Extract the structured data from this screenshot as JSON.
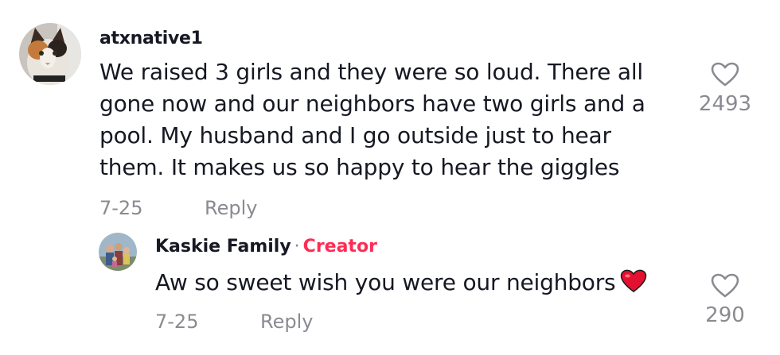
{
  "comment": {
    "username": "atxnative1",
    "avatar_icon": "calico-cat-avatar",
    "text": "We raised 3 girls and they were so loud. There all gone now and our neighbors have two girls and a pool. My husband and I go outside just to hear them. It makes us so happy to hear the giggles",
    "date": "7-25",
    "reply_label": "Reply",
    "like_icon": "heart-outline-icon",
    "like_count": "2493"
  },
  "reply": {
    "username": "Kaskie Family",
    "separator": "·",
    "badge": "Creator",
    "avatar_icon": "family-photo-avatar",
    "text": "Aw so sweet wish you were our neighbors",
    "emoji": "red-heart-emoji",
    "date": "7-25",
    "reply_label": "Reply",
    "like_icon": "heart-outline-icon",
    "like_count": "290"
  },
  "colors": {
    "text": "#161823",
    "muted": "#8a8b91",
    "creator_badge": "#fe2c55",
    "emoji_heart": "#e3102f"
  }
}
